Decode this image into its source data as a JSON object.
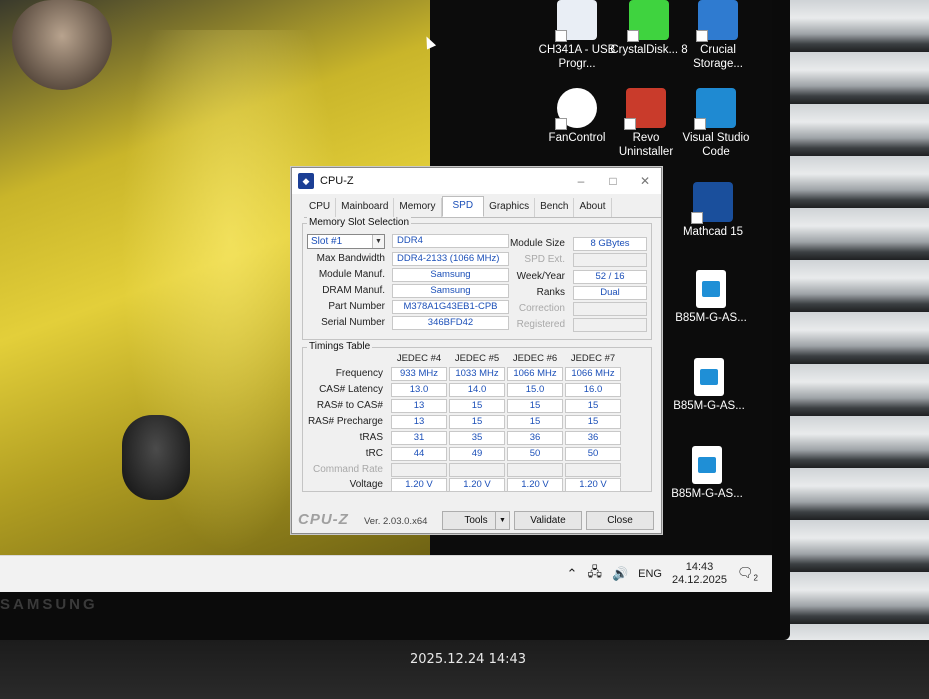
{
  "desktop": {
    "icons": [
      {
        "label": "CH341A - USB Progr..."
      },
      {
        "label": "CrystalDisk... 8"
      },
      {
        "label": "Crucial Storage..."
      },
      {
        "label": "FanControl"
      },
      {
        "label": "Revo Uninstaller"
      },
      {
        "label": "Visual Studio Code"
      },
      {
        "label": "Mathcad 15"
      },
      {
        "label": "B85M-G-AS..."
      },
      {
        "label": "B85M-G-AS..."
      },
      {
        "label": "B85M-G-AS..."
      }
    ]
  },
  "window": {
    "title": "CPU-Z",
    "tabs": [
      "CPU",
      "Mainboard",
      "Memory",
      "SPD",
      "Graphics",
      "Bench",
      "About"
    ],
    "active_tab": "SPD",
    "slot_group_label": "Memory Slot Selection",
    "slot_selected": "Slot #1",
    "memory_type": "DDR4",
    "fields": {
      "max_bandwidth_label": "Max Bandwidth",
      "max_bandwidth": "DDR4-2133 (1066 MHz)",
      "module_manuf_label": "Module Manuf.",
      "module_manuf": "Samsung",
      "dram_manuf_label": "DRAM Manuf.",
      "dram_manuf": "Samsung",
      "part_number_label": "Part Number",
      "part_number": "M378A1G43EB1-CPB",
      "serial_number_label": "Serial Number",
      "serial_number": "346BFD42",
      "module_size_label": "Module Size",
      "module_size": "8 GBytes",
      "spd_ext_label": "SPD Ext.",
      "week_year_label": "Week/Year",
      "week_year": "52 / 16",
      "ranks_label": "Ranks",
      "ranks": "Dual",
      "correction_label": "Correction",
      "registered_label": "Registered"
    },
    "timings_label": "Timings Table",
    "timing_columns": [
      "JEDEC #4",
      "JEDEC #5",
      "JEDEC #6",
      "JEDEC #7"
    ],
    "timing_rows": [
      {
        "label": "Frequency",
        "values": [
          "933 MHz",
          "1033 MHz",
          "1066 MHz",
          "1066 MHz"
        ]
      },
      {
        "label": "CAS# Latency",
        "values": [
          "13.0",
          "14.0",
          "15.0",
          "16.0"
        ]
      },
      {
        "label": "RAS# to CAS#",
        "values": [
          "13",
          "15",
          "15",
          "15"
        ]
      },
      {
        "label": "RAS# Precharge",
        "values": [
          "13",
          "15",
          "15",
          "15"
        ]
      },
      {
        "label": "tRAS",
        "values": [
          "31",
          "35",
          "36",
          "36"
        ]
      },
      {
        "label": "tRC",
        "values": [
          "44",
          "49",
          "50",
          "50"
        ]
      },
      {
        "label": "Command Rate",
        "values": [
          "",
          "",
          "",
          ""
        ]
      },
      {
        "label": "Voltage",
        "values": [
          "1.20 V",
          "1.20 V",
          "1.20 V",
          "1.20 V"
        ]
      }
    ],
    "footer": {
      "logo": "CPU-Z",
      "version": "Ver. 2.03.0.x64",
      "tools": "Tools",
      "validate": "Validate",
      "close": "Close"
    }
  },
  "taskbar": {
    "language": "ENG",
    "time": "14:43",
    "date": "24.12.2025",
    "notifications": "2"
  },
  "monitor_brand": "SAMSUNG",
  "photo_timestamp": "2025.12.24 14:43"
}
